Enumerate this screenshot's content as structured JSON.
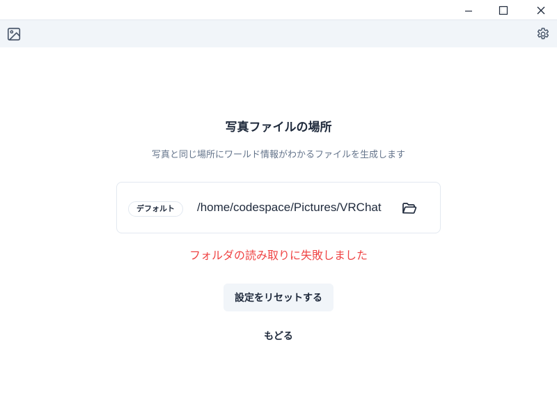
{
  "window": {
    "minimize_icon": "minimize-icon",
    "maximize_icon": "maximize-icon",
    "close_icon": "close-icon"
  },
  "toolbar": {
    "left_icon": "image-icon",
    "right_icon": "gear-icon"
  },
  "page": {
    "title": "写真ファイルの場所",
    "subtitle": "写真と同じ場所にワールド情報がわかるファイルを生成します",
    "path": {
      "badge": "デフォルト",
      "value": "/home/codespace/Pictures/VRChat",
      "folder_icon": "folder-open-icon"
    },
    "error": "フォルダの読み取りに失敗しました",
    "reset_button": "設定をリセットする",
    "back_link": "もどる"
  },
  "colors": {
    "toolbar_bg": "#f1f5f9",
    "error": "#ef4444",
    "text": "#1e293b",
    "muted": "#64748b",
    "border": "#e2e8f0"
  }
}
